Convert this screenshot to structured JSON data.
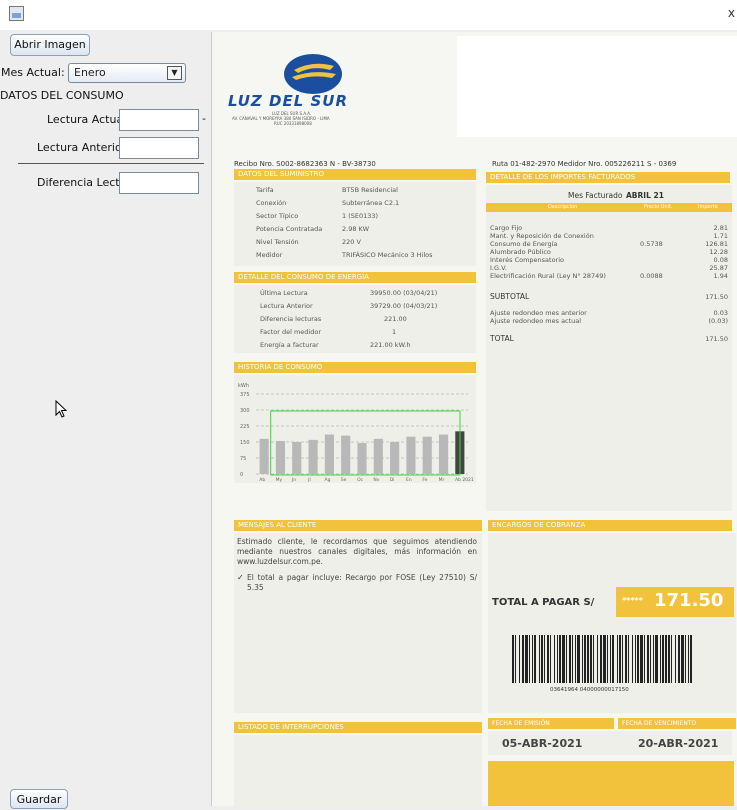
{
  "window": {
    "close_glyph": "x"
  },
  "form": {
    "open_image_label": "Abrir Imagen",
    "month_label": "Mes Actual:",
    "month_value": "Enero",
    "section_title": "DATOS DEL CONSUMO",
    "current_reading_label": "Lectura Actual:",
    "current_reading_value": "",
    "current_reading_dash": "-",
    "previous_reading_label": "Lectura Anterior:",
    "previous_reading_value": "",
    "difference_label": "Diferencia Lect...",
    "difference_value": "",
    "save_label": "Guardar"
  },
  "bill": {
    "logo_text": "LUZ DEL SUR",
    "logo_sub1": "LUZ DEL SUR S.A.A.",
    "logo_sub2": "AV. CANAVAL Y MOREYRA 380 SAN ISIDRO - LIMA",
    "logo_sub3": "RUC 20331898008",
    "receipt_line": "Recibo Nro. S002-8682363  N - BV-38730",
    "route_line": "Ruta 01-482-2970  Medidor Nro. 005226211 S - 0369",
    "supply_title": "DATOS DEL SUMINISTRO",
    "supply_rows": [
      {
        "k": "Tarifa",
        "v": "BT5B Residencial"
      },
      {
        "k": "Conexión",
        "v": "Subterránea C2.1"
      },
      {
        "k": "Sector Típico",
        "v": "1 (SE0133)"
      },
      {
        "k": "Potencia Contratada",
        "v": "2.98 KW"
      },
      {
        "k": "Nivel Tensión",
        "v": "220 V"
      },
      {
        "k": "Medidor",
        "v": "TRIFÁSICO Mecánico 3 Hilos"
      }
    ],
    "consumption_title": "DETALLE DEL CONSUMO DE ENERGÍA",
    "consumption_rows": [
      {
        "k": "Última Lectura",
        "v": "39950.00 (03/04/21)"
      },
      {
        "k": "Lectura Anterior",
        "v": "39729.00 (04/03/21)"
      },
      {
        "k": "Diferencia lecturas",
        "v": "221.00"
      },
      {
        "k": "Factor del medidor",
        "v": "1"
      },
      {
        "k": "Energía a facturar",
        "v": "221.00  kW.h"
      }
    ],
    "history_title": "HISTORIA DE CONSUMO",
    "history_unit": "kWh",
    "history_ticks": [
      "375",
      "300",
      "225",
      "150",
      "75",
      "0"
    ],
    "history_months": [
      "Ab",
      "My",
      "Jn",
      "Jl",
      "Ag",
      "Se",
      "Oc",
      "Nv",
      "Di",
      "En",
      "Fe",
      "Mr",
      "Ab 2021"
    ],
    "amounts_title": "DETALLE DE LOS IMPORTES FACTURADOS",
    "month_billed_label": "Mes Facturado",
    "month_billed_value": "ABRIL 21",
    "amounts_headers": [
      "Descripción",
      "Precio Unit.",
      "Importe"
    ],
    "amount_rows": [
      {
        "d": "Cargo Fijo",
        "p": "",
        "i": "2.81"
      },
      {
        "d": "Mant. y Reposición de Conexión",
        "p": "",
        "i": "1.71"
      },
      {
        "d": "Consumo de Energía",
        "p": "0.5738",
        "i": "126.81"
      },
      {
        "d": "Alumbrado Público",
        "p": "",
        "i": "12.28"
      },
      {
        "d": "Interés Compensatorio",
        "p": "",
        "i": "0.08"
      },
      {
        "d": "I.G.V.",
        "p": "",
        "i": "25.87"
      },
      {
        "d": "Electrificación Rural (Ley N° 28749)",
        "p": "0.0088",
        "i": "1.94"
      }
    ],
    "subtotal_label": "SUBTOTAL",
    "subtotal_value": "171.50",
    "adjust_prev_label": "Ajuste redondeo mes anterior",
    "adjust_prev_value": "0.03",
    "adjust_curr_label": "Ajuste redondeo mes actual",
    "adjust_curr_value": "(0.03)",
    "total_label": "TOTAL",
    "total_value": "171.50",
    "messages_title": "MENSAJES AL CLIENTE",
    "message_1": "Estimado cliente, le recordamos que seguimos atendiendo mediante nuestros canales digitales, más información en www.luzdelsur.com.pe.",
    "message_2": "El total a pagar incluye: Recargo por FOSE (Ley 27510) S/ 5.35",
    "charges_title": "ENCARGOS DE COBRANZA",
    "total_pay_label": "TOTAL A PAGAR S/",
    "total_pay_stars": "*****",
    "total_pay_value": "171.50",
    "barcode_number": "03641964 04000000017150",
    "outages_title": "LISTADO DE INTERRUPCIONES",
    "issue_title": "FECHA DE EMISIÓN",
    "issue_date": "05-ABR-2021",
    "due_title": "FECHA DE VENCIMIENTO",
    "due_date": "20-ABR-2021"
  },
  "chart_data": {
    "type": "bar",
    "categories": [
      "Ab",
      "My",
      "Jn",
      "Jl",
      "Ag",
      "Se",
      "Oc",
      "Nv",
      "Di",
      "En",
      "Fe",
      "Mr",
      "Ab 2021"
    ],
    "values": [
      165,
      155,
      150,
      160,
      185,
      180,
      145,
      165,
      150,
      175,
      175,
      185,
      200
    ],
    "ylim": [
      0,
      375
    ],
    "ylabel": "kWh",
    "highlight_last": true
  },
  "colors": {
    "accent_yellow": "#f2c23c",
    "logo_blue": "#1c4ea0",
    "highlight_green": "#3bd43b"
  }
}
